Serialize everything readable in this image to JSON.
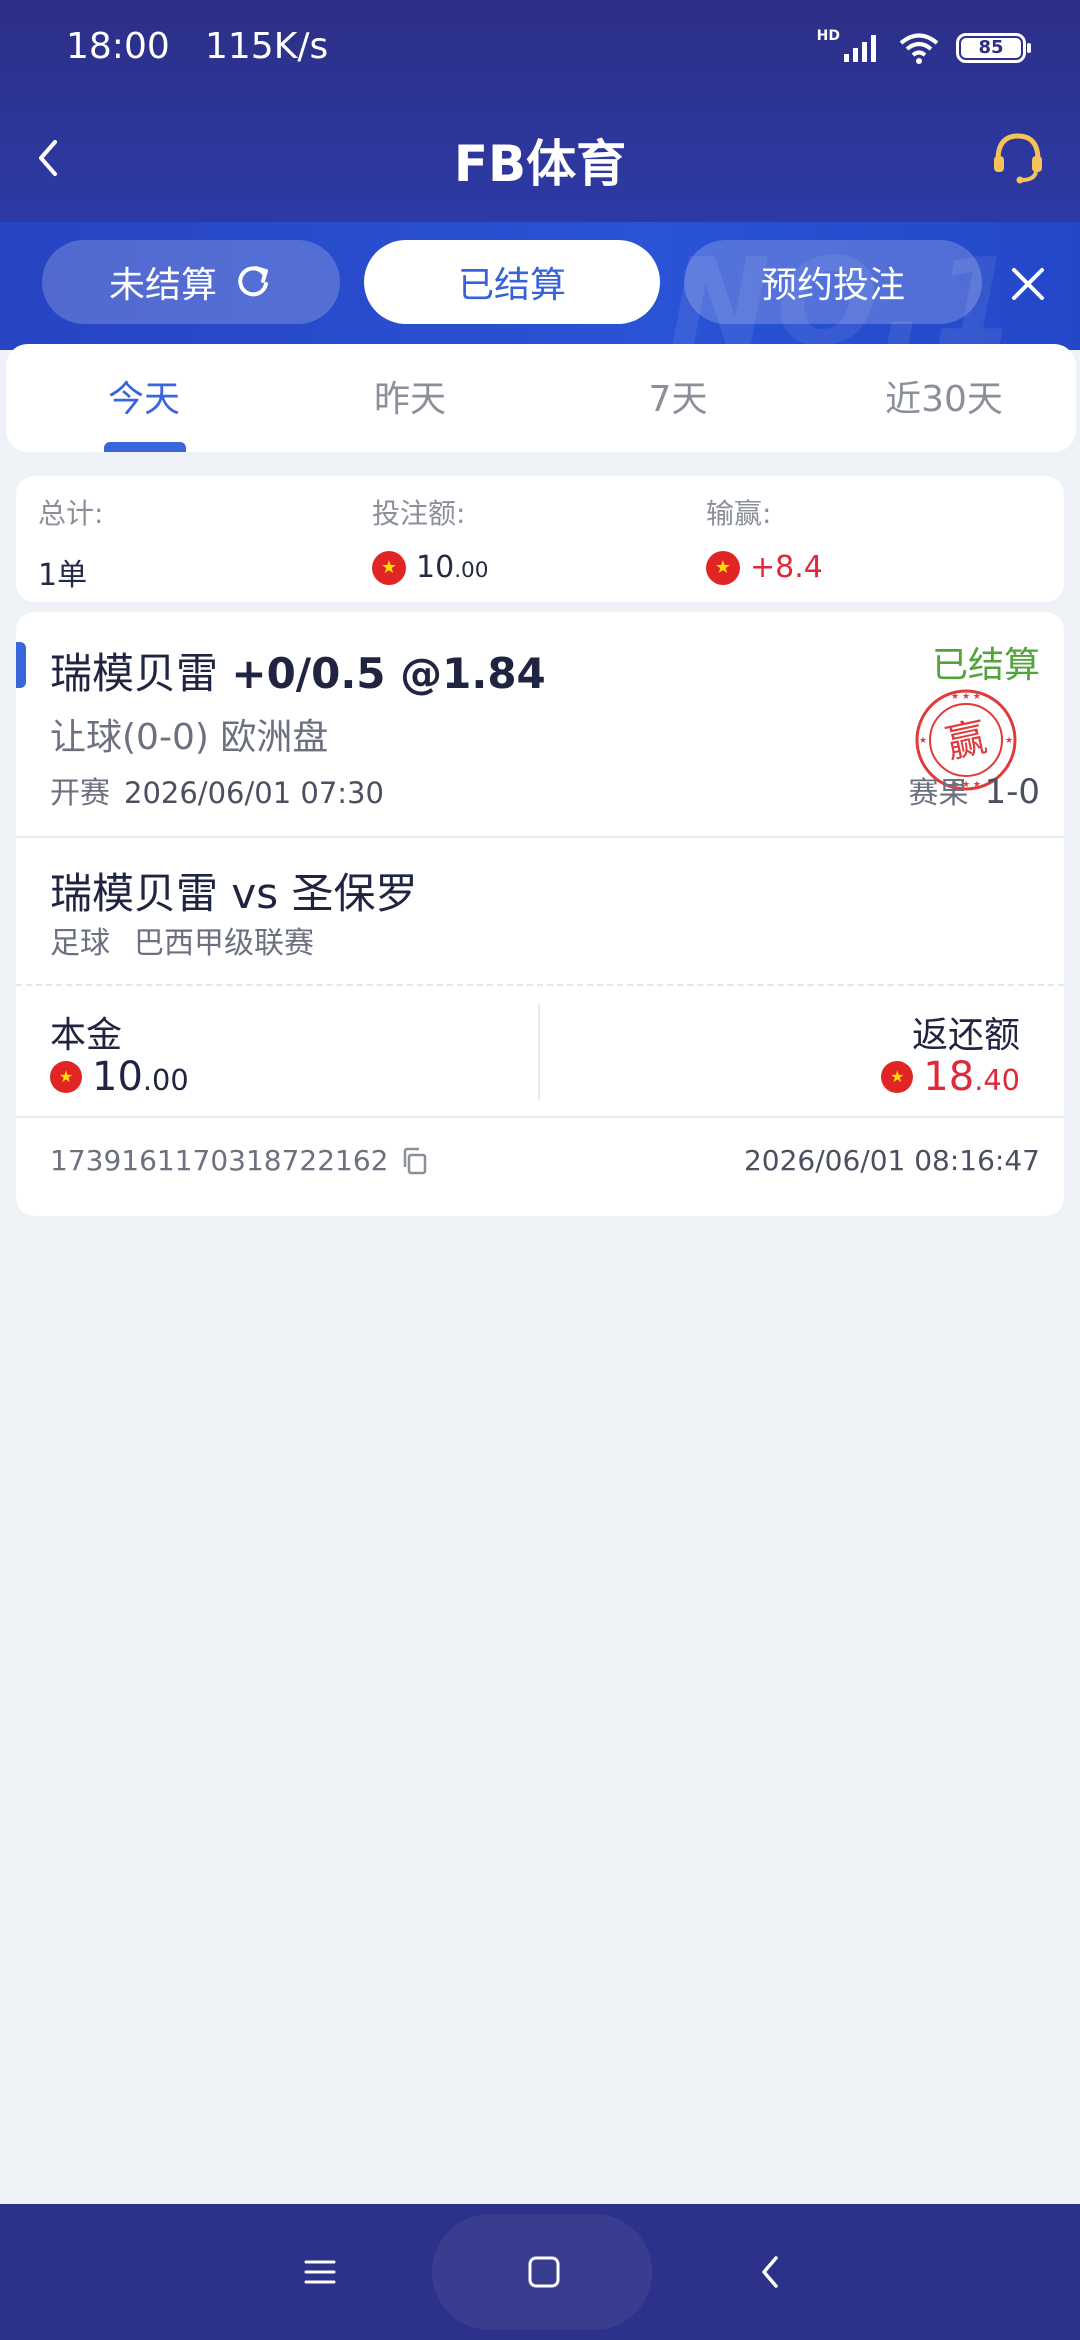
{
  "status_bar": {
    "time": "18:00",
    "net_speed": "115K/s",
    "network_label": "HD",
    "battery": "85"
  },
  "header": {
    "title": "FB体育",
    "back_icon": "chevron-left-icon",
    "support_icon": "headset-icon"
  },
  "bet_tabs": [
    {
      "label": "未结算",
      "active": false
    },
    {
      "label": "已结算",
      "active": true
    },
    {
      "label": "预约投注",
      "active": false
    }
  ],
  "watermark": "NO.1",
  "day_tabs": [
    {
      "label": "今天",
      "active": true
    },
    {
      "label": "昨天",
      "active": false
    },
    {
      "label": "7天",
      "active": false
    },
    {
      "label": "近30天",
      "active": false
    }
  ],
  "summary": {
    "total_label": "总计:",
    "total_value": "1单",
    "stake_label": "投注额:",
    "stake_int": "10",
    "stake_dec": ".00",
    "win_label": "输赢:",
    "win_value": "+8.4"
  },
  "bet": {
    "team": "瑞模贝雷",
    "handicap": "+0/0.5 @1.84",
    "status": "已结算",
    "market": "让球(0-0) 欧洲盘",
    "kickoff_label": "开赛",
    "kickoff_time": "2026/06/01 07:30",
    "result_label": "赛果",
    "result_score": "1-0",
    "stamp_text": "赢",
    "match": "瑞模贝雷 vs 圣保罗",
    "sport": "足球",
    "league": "巴西甲级联赛",
    "principal_label": "本金",
    "principal_int": "10",
    "principal_dec": ".00",
    "return_label": "返还额",
    "return_int": "18",
    "return_dec": ".40",
    "order_id": "1739161170318722162",
    "settle_time": "2026/06/01 08:16:47"
  },
  "colors": {
    "header_bg": "#2c2f86",
    "tab_strip_bg": "#2a53d6",
    "accent_blue": "#3a66dc",
    "win_red": "#e0283a",
    "settled_green": "#52a43a",
    "page_bg": "#eef1f5"
  }
}
